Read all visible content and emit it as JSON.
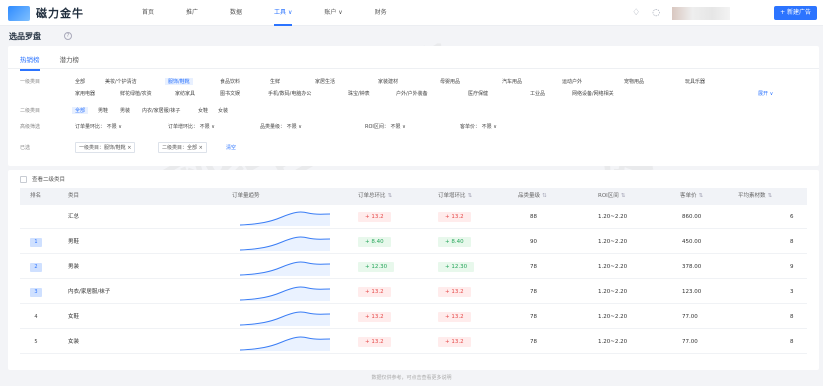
{
  "app": {
    "logo_text": "磁力金牛"
  },
  "nav": [
    {
      "label": "首页",
      "active": false
    },
    {
      "label": "推广",
      "active": false
    },
    {
      "label": "数据",
      "active": false
    },
    {
      "label": "工具 ∨",
      "active": true
    },
    {
      "label": "账户 ∨",
      "active": false
    },
    {
      "label": "财务",
      "active": false
    }
  ],
  "top_right": {
    "bell_icon": "bell-icon",
    "help_icon": "help-icon",
    "create_button": "+ 新建广告"
  },
  "page": {
    "title": "选品罗盘"
  },
  "tabs": [
    {
      "label": "热销榜",
      "active": true
    },
    {
      "label": "潜力榜",
      "active": false
    }
  ],
  "filters": {
    "primary": {
      "label": "一级类目",
      "row1": [
        "全部",
        "美妆/个护清洁",
        "服饰/鞋靴",
        "食品饮料",
        "生鲜",
        "家居生活",
        "家装建材",
        "母婴用品",
        "汽车用品",
        "运动户外",
        "宠物用品",
        "玩具乐器"
      ],
      "row2": [
        "家用电器",
        "鲜花绿植/农资",
        "家纺家具",
        "图书文娱",
        "手机/数码/电脑办公",
        "珠宝/钟表",
        "户外/户外装备",
        "医疗保健",
        "工业品",
        "网络设备/网络相关"
      ],
      "selected": "服饰/鞋靴",
      "expand": "展开 ∨"
    },
    "secondary": {
      "label": "二级类目",
      "options": [
        "全部",
        "男鞋",
        "男装",
        "内衣/家居服/袜子",
        "女鞋",
        "女装"
      ],
      "selected": "全部"
    },
    "advanced": {
      "label": "高级筛选",
      "items": [
        {
          "name": "订单量环比",
          "value": "不限 ∨"
        },
        {
          "name": "订单增环比",
          "value": "不限 ∨"
        },
        {
          "name": "品类量级",
          "value": "不限 ∨"
        },
        {
          "name": "ROI区间",
          "value": "不限 ∨"
        },
        {
          "name": "客单价",
          "value": "不限 ∨"
        }
      ]
    },
    "selected": {
      "label": "已选",
      "tags": [
        "一级类目：服饰/鞋靴 ×",
        "二级类目：全部 ×"
      ],
      "clear": "清空"
    }
  },
  "table": {
    "show_level2_label": "查看二级类目",
    "columns": [
      "排名",
      "类目",
      "订单量趋势",
      "订单总环比",
      "订单增环比",
      "品类量级",
      "ROI区间",
      "客单价",
      "平均素材数"
    ],
    "rows": [
      {
        "rank": "",
        "category": "汇总",
        "order_total": "+ 13.2",
        "order_total_color": "red",
        "order_growth": "+ 13.2",
        "order_growth_color": "red",
        "scale": "88",
        "roi": "1.20~2.20",
        "price": "860.00",
        "materials": "6"
      },
      {
        "rank": "1",
        "category": "男鞋",
        "order_total": "+ 8.40",
        "order_total_color": "green",
        "order_growth": "+ 8.40",
        "order_growth_color": "green",
        "scale": "90",
        "roi": "1.20~2.20",
        "price": "450.00",
        "materials": "8"
      },
      {
        "rank": "2",
        "category": "男装",
        "order_total": "+ 12.30",
        "order_total_color": "green",
        "order_growth": "+ 12.30",
        "order_growth_color": "green",
        "scale": "78",
        "roi": "1.20~2.20",
        "price": "378.00",
        "materials": "9"
      },
      {
        "rank": "3",
        "category": "内衣/家居服/袜子",
        "order_total": "+ 13.2",
        "order_total_color": "red",
        "order_growth": "+ 13.2",
        "order_growth_color": "red",
        "scale": "78",
        "roi": "1.20~2.20",
        "price": "123.00",
        "materials": "3"
      },
      {
        "rank": "4",
        "category": "女鞋",
        "order_total": "+ 13.2",
        "order_total_color": "red",
        "order_growth": "+ 13.2",
        "order_growth_color": "red",
        "scale": "78",
        "roi": "1.20~2.20",
        "price": "77.00",
        "materials": "8"
      },
      {
        "rank": "5",
        "category": "女装",
        "order_total": "+ 13.2",
        "order_total_color": "red",
        "order_growth": "+ 13.2",
        "order_growth_color": "red",
        "scale": "78",
        "roi": "1.20~2.20",
        "price": "77.00",
        "materials": "8"
      }
    ]
  },
  "footer": {
    "text": "数据仅供参考，可点击查看更多说明"
  },
  "watermark": {
    "text": "巨宣网络"
  },
  "colors": {
    "accent": "#2c74ff",
    "red": "#e64a4a",
    "green": "#25a55a"
  }
}
